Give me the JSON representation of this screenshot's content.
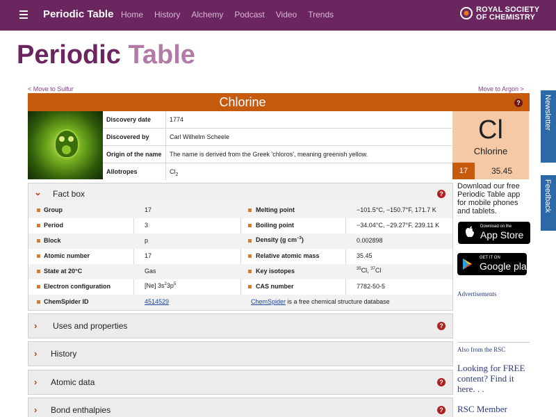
{
  "header": {
    "brand": "Periodic Table",
    "nav": [
      "Home",
      "History",
      "Alchemy",
      "Podcast",
      "Video",
      "Trends"
    ],
    "rsc_line1": "ROYAL SOCIETY",
    "rsc_line2": "OF CHEMISTRY"
  },
  "page_title": {
    "part1": "Periodic",
    "part2": "Table"
  },
  "links": {
    "prev": "< Move to Sulfur",
    "next": "Move to Argon >"
  },
  "element": {
    "name": "Chlorine",
    "symbol": "Cl",
    "atomic_number": "17",
    "atomic_mass": "35.45",
    "help": "?"
  },
  "info": [
    {
      "key": "Discovery date",
      "value": "1774"
    },
    {
      "key": "Discovered by",
      "value": "Carl Wilhelm Scheele"
    },
    {
      "key": "Origin of the name",
      "value": "The name is derived from the Greek 'chloros', meaning greenish yellow."
    },
    {
      "key": "Allotropes",
      "value": "Cl",
      "sub": "2"
    }
  ],
  "factbox": {
    "title": "Fact box",
    "rows": [
      {
        "k1": "Group",
        "v1": "17",
        "k2": "Melting point",
        "v2": "−101.5°C, −150.7°F, 171.7 K"
      },
      {
        "k1": "Period",
        "v1": "3",
        "k2": "Boiling point",
        "v2": "−34.04°C, −29.27°F, 239.11 K"
      },
      {
        "k1": "Block",
        "v1": "p",
        "k2": "Density (g cm",
        "k2sup": "−3",
        "k2end": ")",
        "v2": "0.002898"
      },
      {
        "k1": "Atomic number",
        "v1": "17",
        "k2": "Relative atomic mass",
        "v2": "35.45"
      },
      {
        "k1": "State at 20°C",
        "v1": "Gas",
        "k2": "Key isotopes",
        "v2a": "35",
        "v2b": "Cl, ",
        "v2c": "37",
        "v2d": "Cl"
      },
      {
        "k1": "Electron configuration",
        "v1a": "[Ne] 3s",
        "v1b": "2",
        "v1c": "3p",
        "v1d": "5",
        "k2": "CAS number",
        "v2": "7782-50-5"
      }
    ],
    "chemspider": {
      "key": "ChemSpider ID",
      "id": "4514529",
      "link": "ChemSpider",
      "text": " is a free chemical structure database"
    }
  },
  "sections": [
    "Uses and properties",
    "History",
    "Atomic data",
    "Bond enthalpies"
  ],
  "sidebar": {
    "promo": "Download our free Periodic Table app for mobile phones and tablets.",
    "appstore_small": "Download on the",
    "appstore_big": "App Store",
    "play_small": "GET IT ON",
    "play_big": "Google play",
    "ads": "Advertisements",
    "also": "Also from the RSC",
    "free": "Looking for FREE content? Find it here. . .",
    "member": "RSC Member"
  },
  "tabs": {
    "newsletter": "Newsletter",
    "feedback": "Feedback"
  },
  "colors": {
    "header": "#6b2660",
    "accent": "#c65a0d",
    "tile": "#f5c9a6",
    "help": "#b02020"
  }
}
